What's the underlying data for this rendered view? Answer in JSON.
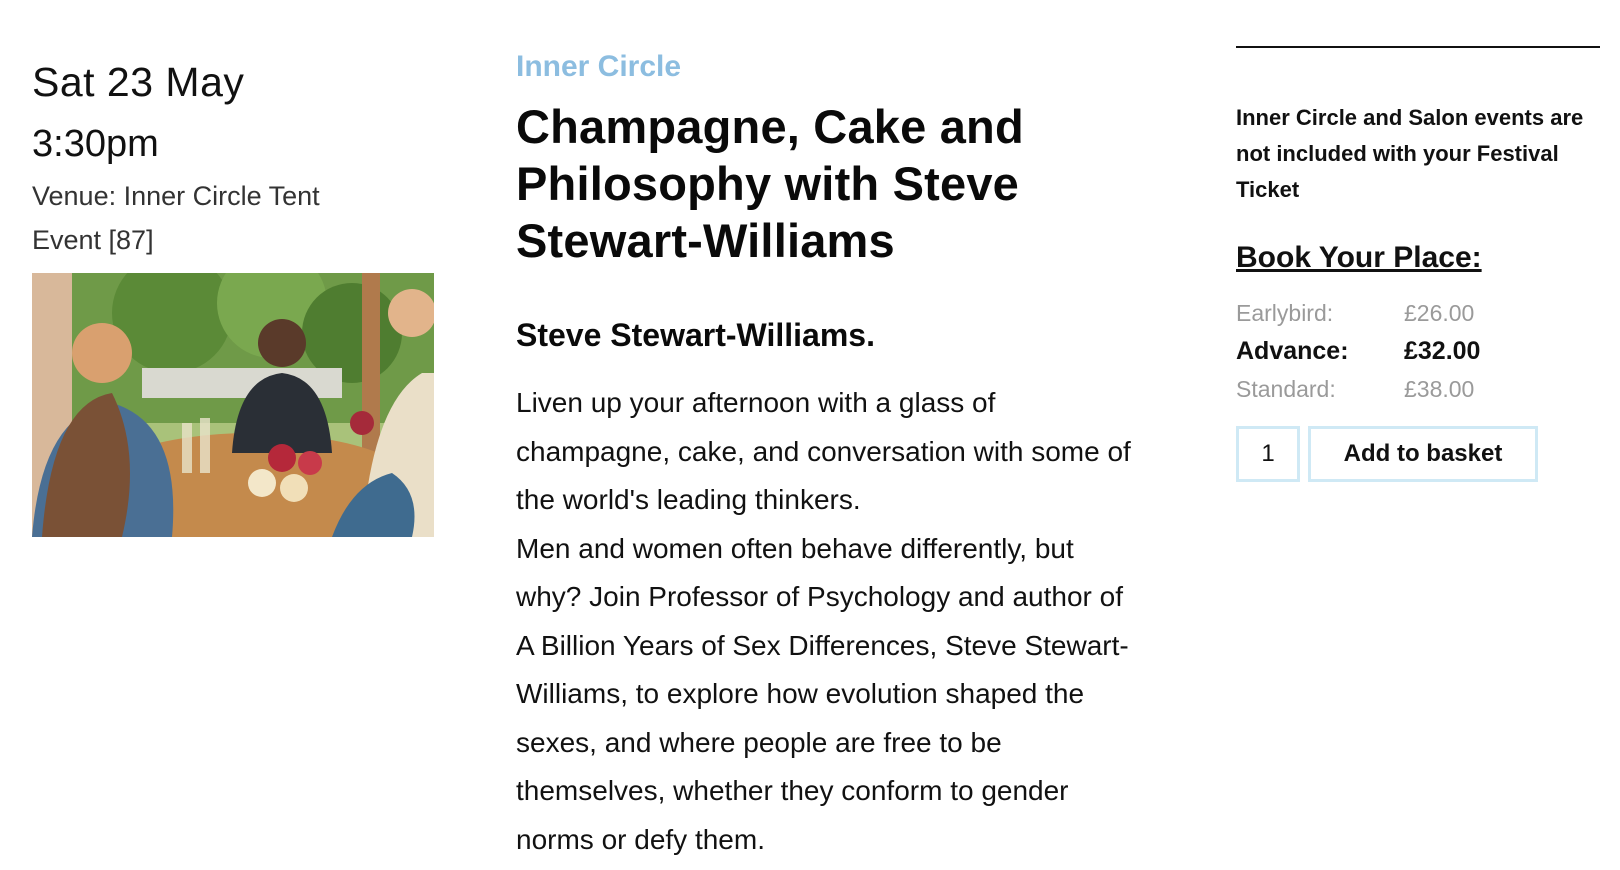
{
  "event": {
    "date": "Sat 23 May",
    "time": "3:30pm",
    "venue": "Venue: Inner Circle Tent",
    "event_number": "Event [87]",
    "category": "Inner Circle",
    "title": "Champagne, Cake and Philosophy with Steve Stewart-Williams",
    "speaker": "Steve Stewart-Williams.",
    "description": [
      "Liven up your afternoon with a glass of champagne, cake, and conversation with some of the world's leading thinkers.",
      "Men and women often behave differently, but why? Join Professor of Psychology and author of A Billion Years of Sex Differences, Steve Stewart-Williams, to explore how evolution shaped the sexes, and where people are free to be themselves, whether they conform to gender norms or defy them."
    ]
  },
  "booking": {
    "notice": "Inner Circle and Salon events are not included with your Festival Ticket",
    "heading": "Book Your Place:",
    "prices": [
      {
        "label": "Earlybird:",
        "value": "£26.00",
        "state": "muted"
      },
      {
        "label": "Advance:",
        "value": "£32.00",
        "state": "active"
      },
      {
        "label": "Standard:",
        "value": "£38.00",
        "state": "muted"
      }
    ],
    "quantity": "1",
    "add_button": "Add to basket"
  },
  "colors": {
    "category": "#8cbde0",
    "button_border": "#cfe9f5",
    "muted_text": "#9a9a9a"
  }
}
